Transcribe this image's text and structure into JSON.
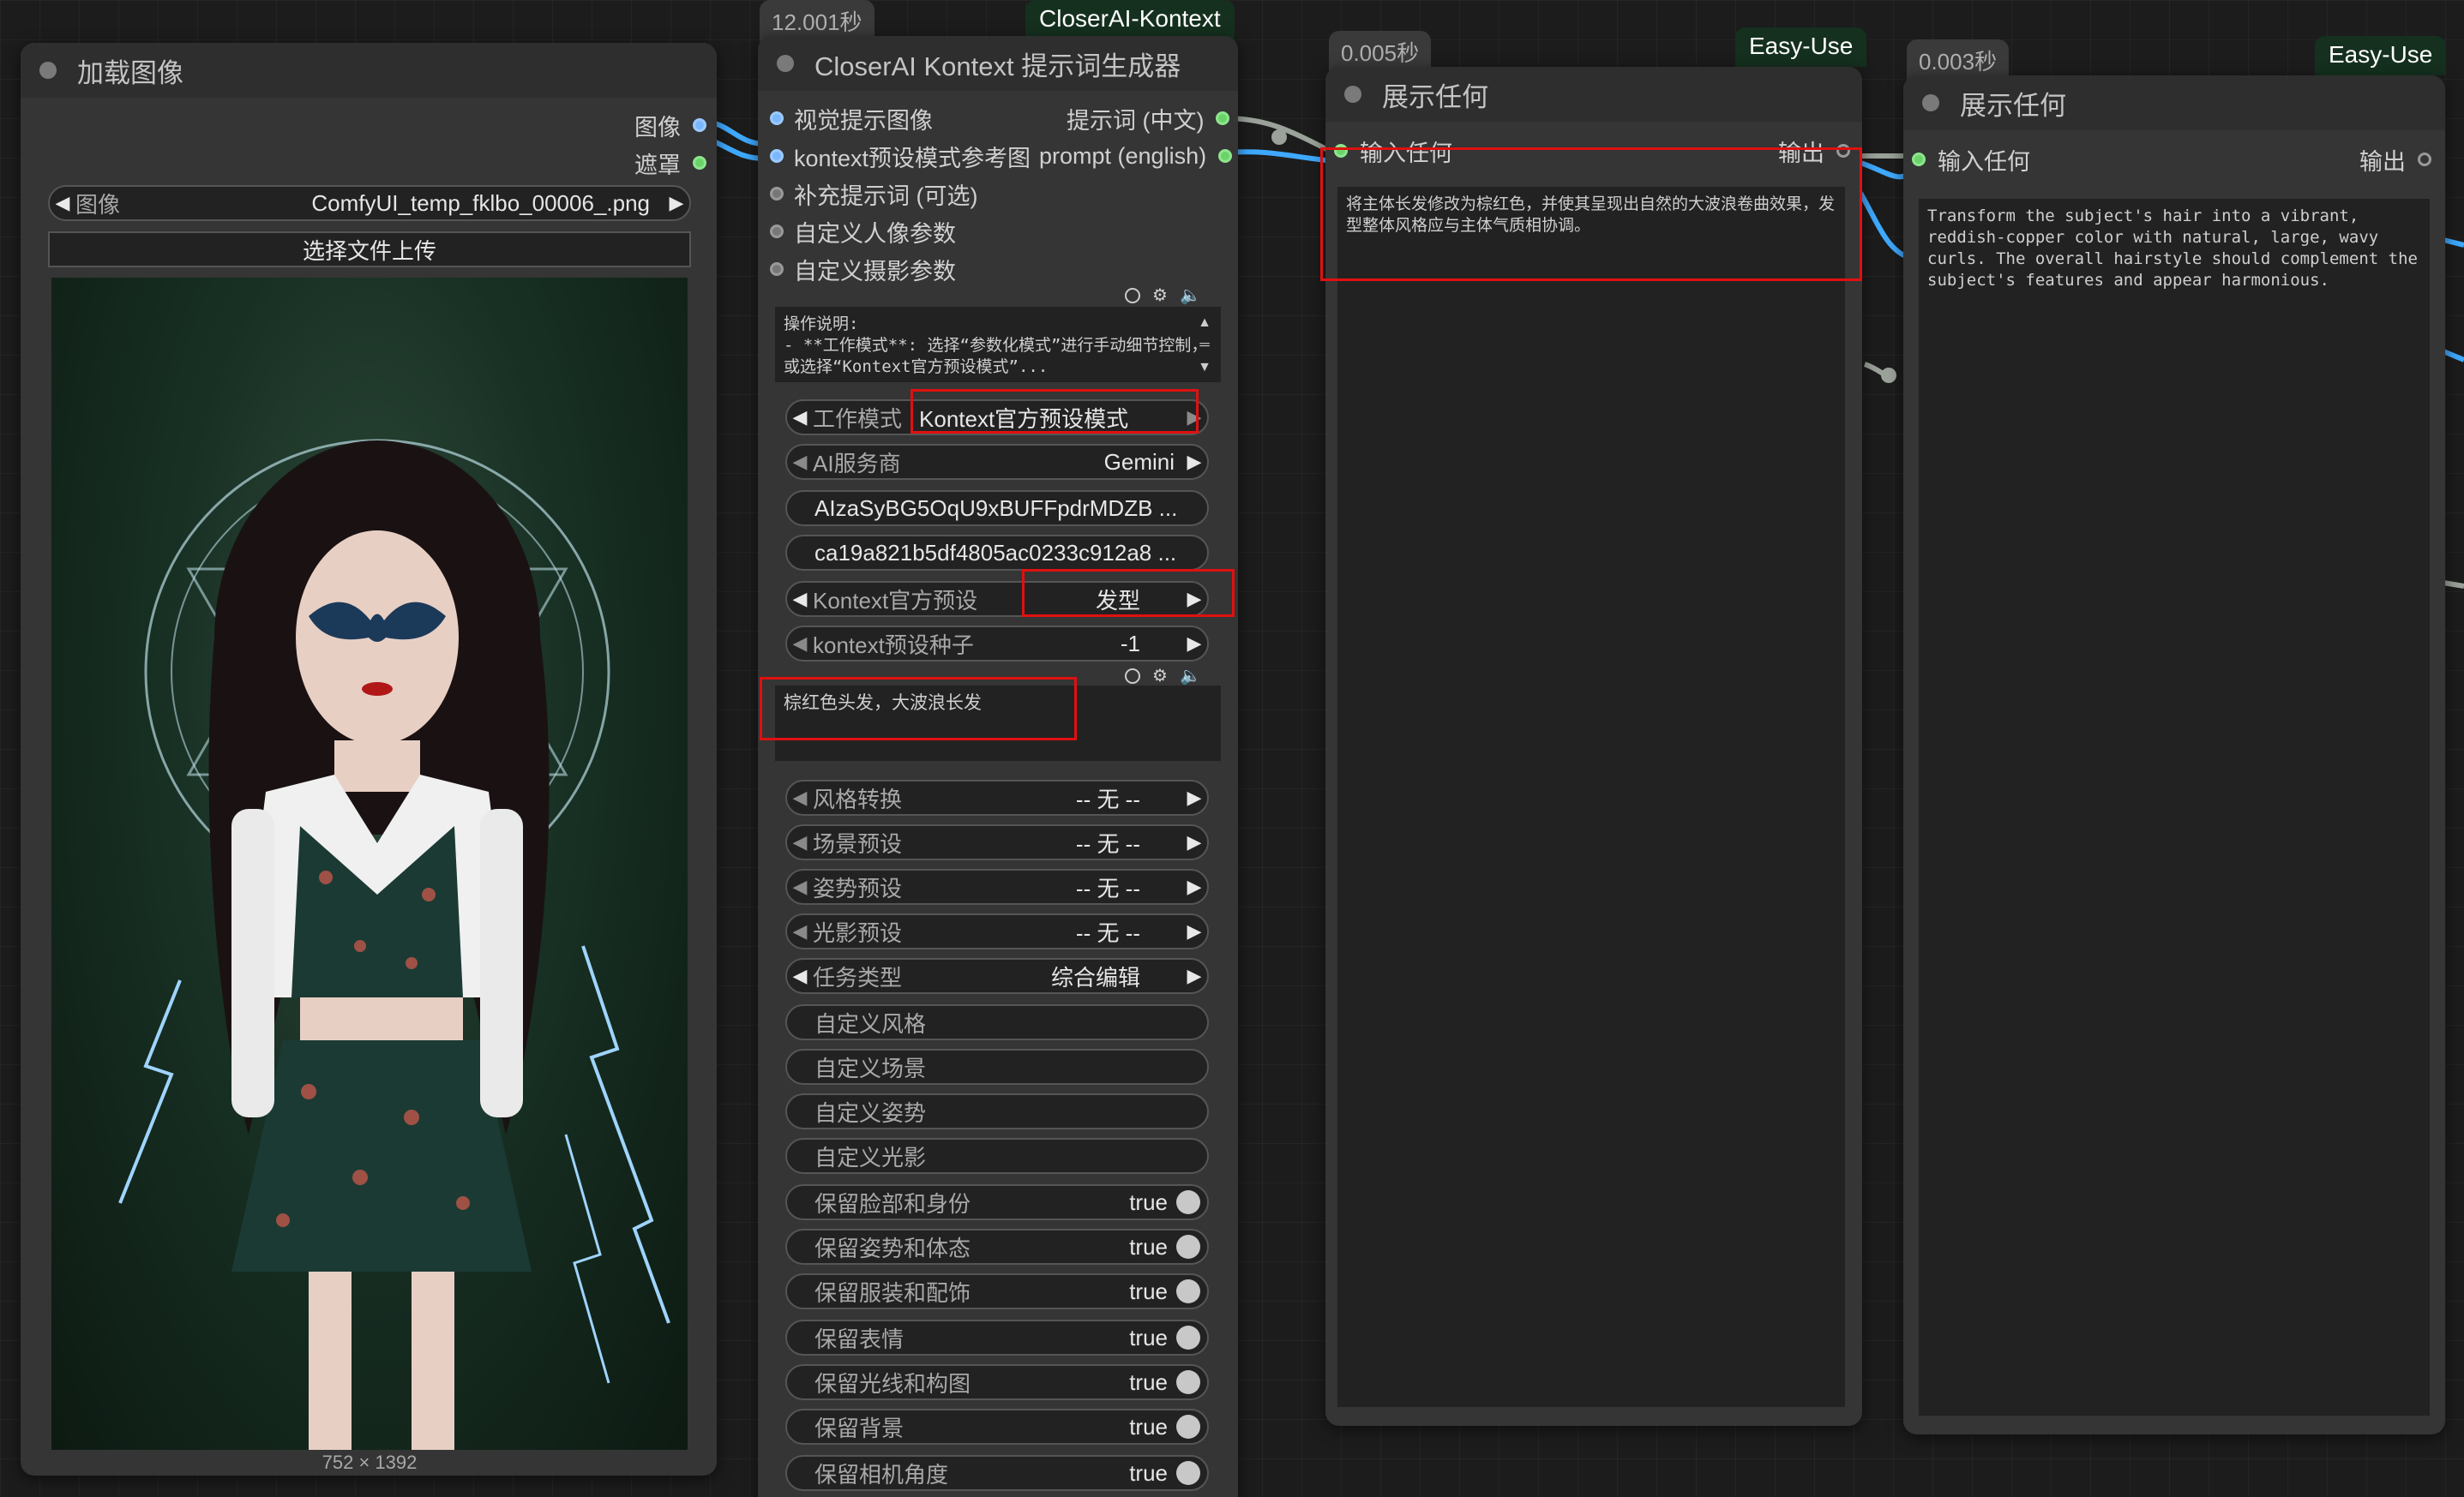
{
  "load_image": {
    "title": "加载图像",
    "out_image": "图像",
    "out_mask": "遮罩",
    "image_label": "图像",
    "image_value": "ComfyUI_temp_fklbo_00006_.png",
    "upload_button": "选择文件上传",
    "dimensions": "752 × 1392"
  },
  "kontext": {
    "time_badge": "12.001秒",
    "group_tag": "CloserAI-Kontext",
    "title": "CloserAI Kontext 提示词生成器",
    "inputs": [
      "视觉提示图像",
      "kontext预设模式参考图",
      "补充提示词 (可选)",
      "自定义人像参数",
      "自定义摄影参数"
    ],
    "outputs": [
      "提示词 (中文)",
      "prompt (english)"
    ],
    "instructions_text": "操作说明:\n- **工作模式**: 选择“参数化模式”进行手动细节控制，或选择“Kontext官方预设模式”...",
    "work_mode_label": "工作模式",
    "work_mode_value": "Kontext官方预设模式",
    "ai_provider_label": "AI服务商",
    "ai_provider_value": "Gemini",
    "api_key_value": "AIzaSyBG5OqU9xBUFFpdrMDZB ...",
    "secret_value": "ca19a821b5df4805ac0233c912a8 ...",
    "preset_label": "Kontext官方预设",
    "preset_value": "发型",
    "seed_label": "kontext预设种子",
    "seed_value": "-1",
    "prompt_text": "棕红色头发，大波浪长发",
    "selects": [
      {
        "label": "风格转换",
        "value": "-- 无 --"
      },
      {
        "label": "场景预设",
        "value": "-- 无 --"
      },
      {
        "label": "姿势预设",
        "value": "-- 无 --"
      },
      {
        "label": "光影预设",
        "value": "-- 无 --"
      },
      {
        "label": "任务类型",
        "value": "综合编辑"
      }
    ],
    "custom_buttons": [
      "自定义风格",
      "自定义场景",
      "自定义姿势",
      "自定义光影"
    ],
    "toggles": [
      {
        "label": "保留脸部和身份",
        "value": "true"
      },
      {
        "label": "保留姿势和体态",
        "value": "true"
      },
      {
        "label": "保留服装和配饰",
        "value": "true"
      },
      {
        "label": "保留表情",
        "value": "true"
      },
      {
        "label": "保留光线和构图",
        "value": "true"
      },
      {
        "label": "保留背景",
        "value": "true"
      },
      {
        "label": "保留相机角度",
        "value": "true"
      }
    ]
  },
  "show1": {
    "time_badge": "0.005秒",
    "group_tag": "Easy-Use",
    "title": "展示任何",
    "input_label": "输入任何",
    "output_label": "输出",
    "text": "将主体长发修改为棕红色，并使其呈现出自然的大波浪卷曲效果，发型整体风格应与主体气质相协调。"
  },
  "show2": {
    "time_badge": "0.003秒",
    "group_tag": "Easy-Use",
    "title": "展示任何",
    "input_label": "输入任何",
    "output_label": "输出",
    "text": "Transform the subject's hair into a vibrant, reddish-copper color with natural, large, wavy curls. The overall hairstyle should complement the subject's features and appear harmonious."
  },
  "colors": {
    "highlight": "#e01010",
    "link_blue": "#3fa9ff",
    "link_grey": "#9aa29a",
    "node_bg": "#353535",
    "canvas_bg": "#1c1c1c"
  }
}
